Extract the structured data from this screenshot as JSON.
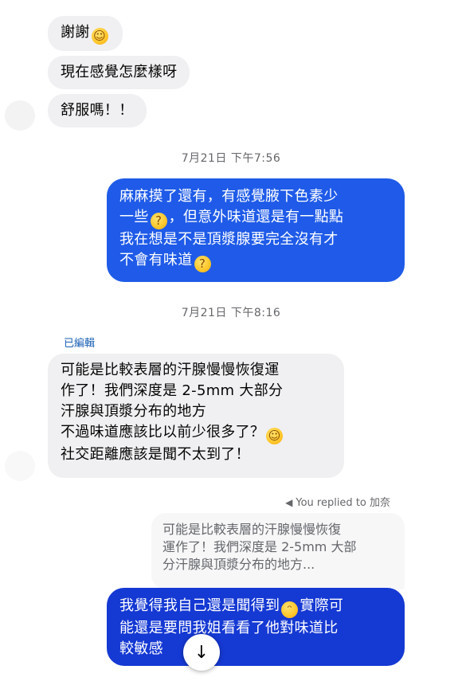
{
  "colors": {
    "incoming_bubble": "#f0f0f2",
    "outgoing_bubble_1": "#1f5be8",
    "outgoing_bubble_2": "#1539d3",
    "timestamp_text": "#65676b",
    "edited_text": "#1a5fb4"
  },
  "messages": [
    {
      "from": "them",
      "parts": [
        "謝謝"
      ],
      "emoji": [
        "blush"
      ]
    },
    {
      "from": "them",
      "text": "現在感覺怎麼樣呀"
    },
    {
      "from": "them",
      "text": "舒服嗎！！"
    }
  ],
  "timestamp1": "7月21日 下午7:56",
  "outgoing1": {
    "line1": "麻麻摸了還有，有感覺腋下色素少",
    "line2a": "一些",
    "line2b": "，但意外味道還是有一點點",
    "line3": "我在想是不是頂漿腺要完全沒有才",
    "line4": "不會有味道"
  },
  "timestamp2": "7月21日 下午8:16",
  "edited_label": "已編輯",
  "incoming_long": {
    "line1": "可能是比較表層的汗腺慢慢恢復運",
    "line2": "作了！我們深度是 2-5mm 大部分",
    "line3": "汗腺與頂漿分布的地方",
    "line4": "不過味道應該比以前少很多了？",
    "line5": "社交距離應該是聞不太到了！"
  },
  "reply_meta": "You replied to 加奈",
  "quoted": {
    "line1": "可能是比較表層的汗腺慢慢恢復",
    "line2": "運作了！我們深度是 2-5mm 大部",
    "line3": "分汗腺與頂漿分布的地方..."
  },
  "outgoing2": {
    "line1a": "我覺得我自己還是聞得到",
    "line1b": "實際可",
    "line2": "能還是要問我姐看看了他對味道比",
    "line3": "較敏感"
  },
  "icons": {
    "scroll_down": "arrow-down-icon",
    "reply": "reply-arrow-icon",
    "emoji_blush": "smiling-face-icon",
    "emoji_thinking": "thinking-face-icon",
    "emoji_grin": "grinning-squinting-face-icon"
  }
}
